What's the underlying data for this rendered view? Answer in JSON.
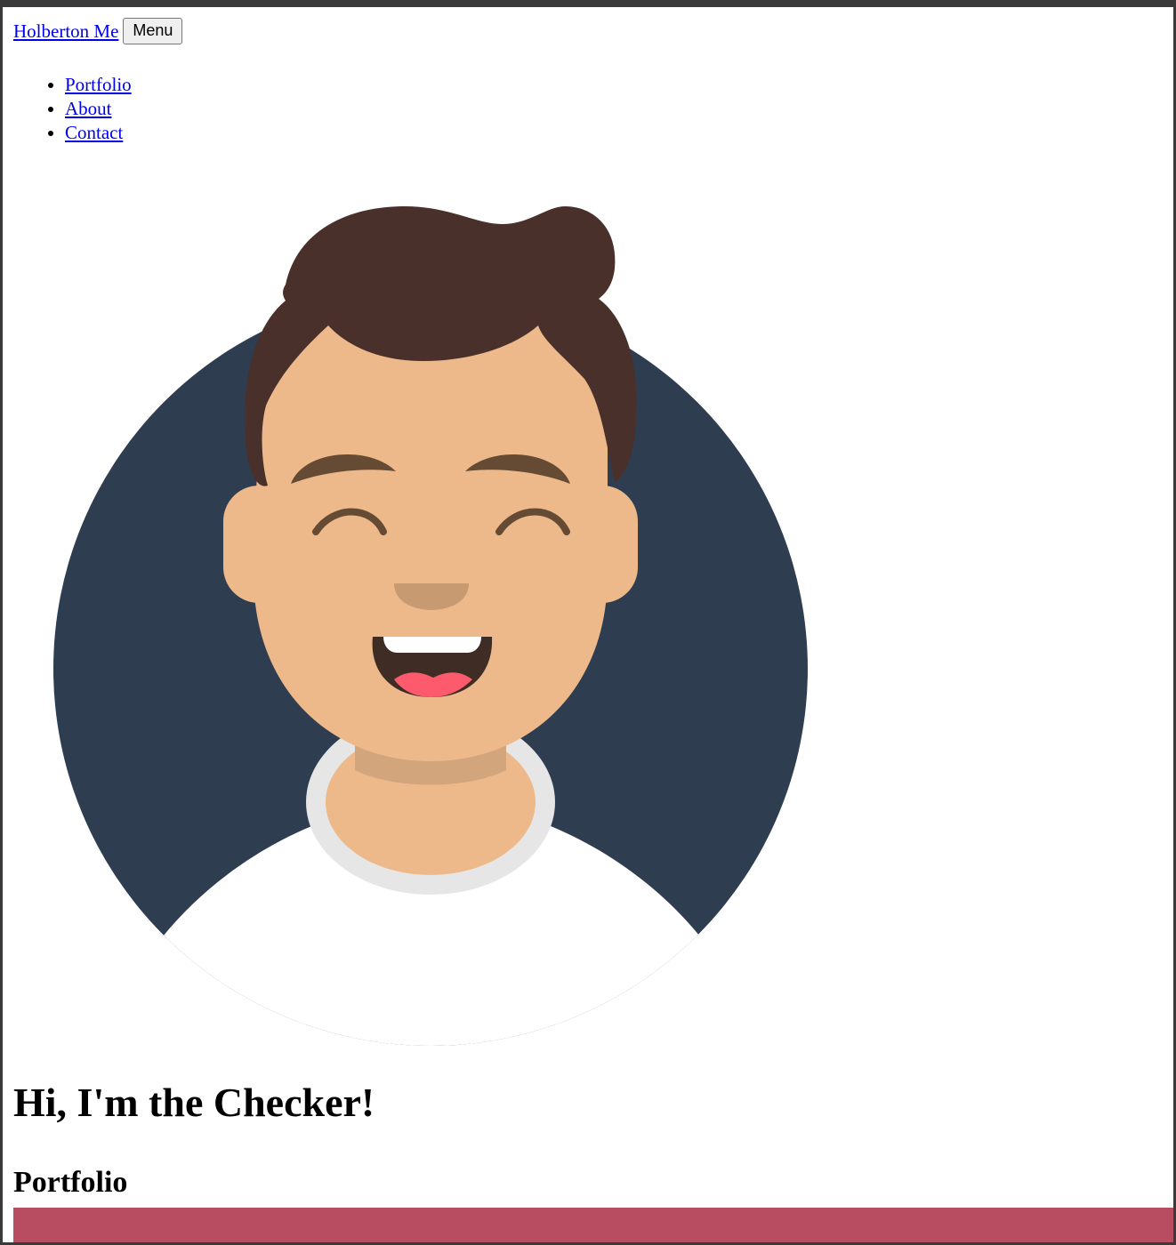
{
  "nav": {
    "brand": "Holberton Me",
    "menu_button": "Menu",
    "items": [
      {
        "label": "Portfolio"
      },
      {
        "label": "About"
      },
      {
        "label": "Contact"
      }
    ]
  },
  "hero": {
    "title": "Hi, I'm the Checker!",
    "avatar_icon": "smiling-avatar-icon"
  },
  "portfolio": {
    "heading": "Portfolio"
  },
  "colors": {
    "link": "#0000ee",
    "avatar_background": "#2e3d50",
    "hair": "#4a302b",
    "skin": "#edb98a",
    "portfolio_bar": "#b84d62"
  }
}
